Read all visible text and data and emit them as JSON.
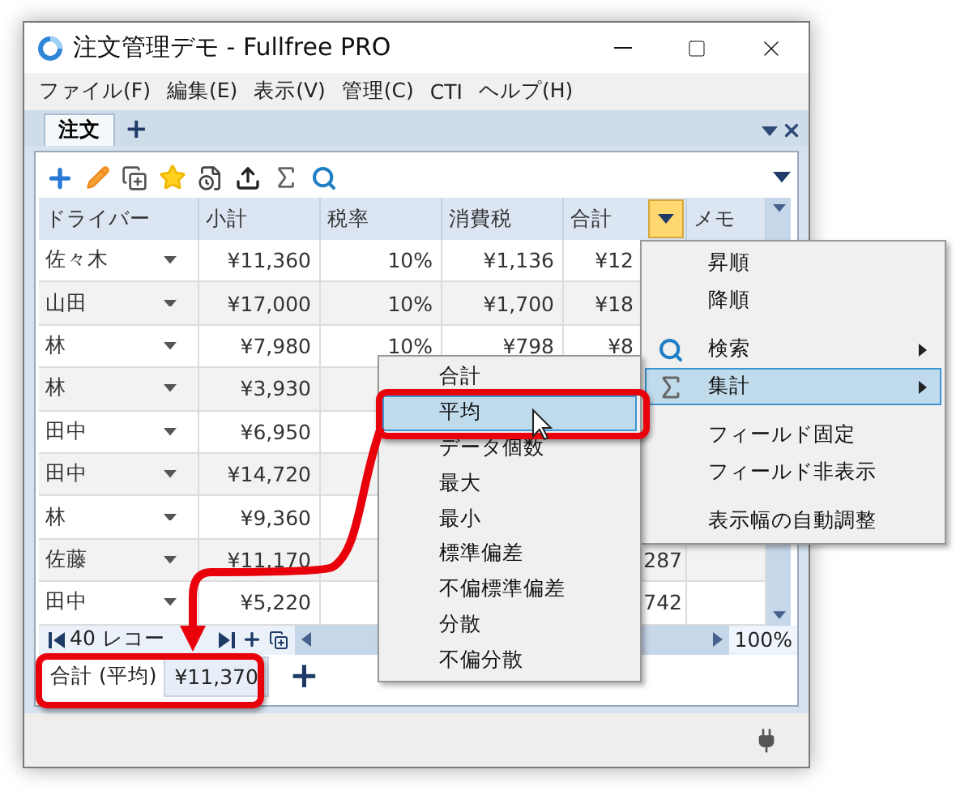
{
  "window": {
    "title": "注文管理デモ - Fullfree PRO"
  },
  "menu_bar": [
    "ファイル(F)",
    "編集(E)",
    "表示(V)",
    "管理(C)",
    "CTI",
    "ヘルプ(H)"
  ],
  "tabs": [
    {
      "label": "注文",
      "selected": true
    }
  ],
  "new_tab": "+",
  "table": {
    "columns": [
      "ドライバー",
      "小計",
      "税率",
      "消費税",
      "合計",
      "メモ"
    ],
    "rows": [
      {
        "driver": "佐々木",
        "subtotal": "¥11,360",
        "tax_rate": "10%",
        "tax": "¥1,136",
        "total": "¥12"
      },
      {
        "driver": "山田",
        "subtotal": "¥17,000",
        "tax_rate": "10%",
        "tax": "¥1,700",
        "total": "¥18"
      },
      {
        "driver": "林",
        "subtotal": "¥7,980",
        "tax_rate": "10%",
        "tax": "¥798",
        "total": "¥8"
      },
      {
        "driver": "林",
        "subtotal": "¥3,930"
      },
      {
        "driver": "田中",
        "subtotal": "¥6,950"
      },
      {
        "driver": "田中",
        "subtotal": "¥14,720"
      },
      {
        "driver": "林",
        "subtotal": "¥9,360"
      },
      {
        "driver": "佐藤",
        "subtotal": "¥11,170",
        "total": "287"
      },
      {
        "driver": "田中",
        "subtotal": "¥5,220",
        "total": "742"
      }
    ]
  },
  "navigator": {
    "record_count": "40 レコー",
    "zoom": "100%"
  },
  "summary": {
    "label": "合計 (平均)",
    "value": "¥11,370",
    "add": "+"
  },
  "context_menu": [
    {
      "label": "昇順",
      "kind": "plain",
      "submenu": false,
      "selected": false,
      "separator_before": false
    },
    {
      "label": "降順",
      "kind": "plain",
      "submenu": false,
      "selected": false,
      "separator_before": false
    },
    {
      "label": "検索",
      "kind": "search",
      "submenu": true,
      "selected": false,
      "separator_before": true
    },
    {
      "label": "集計",
      "kind": "sum",
      "submenu": true,
      "selected": true,
      "separator_before": false
    },
    {
      "label": "フィールド固定",
      "kind": "plain",
      "submenu": false,
      "selected": false,
      "separator_before": true
    },
    {
      "label": "フィールド非表示",
      "kind": "plain",
      "submenu": false,
      "selected": false,
      "separator_before": false
    },
    {
      "label": "表示幅の自動調整",
      "kind": "plain",
      "submenu": false,
      "selected": false,
      "separator_before": true
    }
  ],
  "aggregate_menu": [
    {
      "label": "合計",
      "selected": false
    },
    {
      "label": "平均",
      "selected": true
    },
    {
      "label": "データ個数",
      "selected": false
    },
    {
      "label": "最大",
      "selected": false
    },
    {
      "label": "最小",
      "selected": false
    },
    {
      "label": "標準偏差",
      "selected": false
    },
    {
      "label": "不偏標準偏差",
      "selected": false
    },
    {
      "label": "分散",
      "selected": false
    },
    {
      "label": "不偏分散",
      "selected": false
    }
  ]
}
